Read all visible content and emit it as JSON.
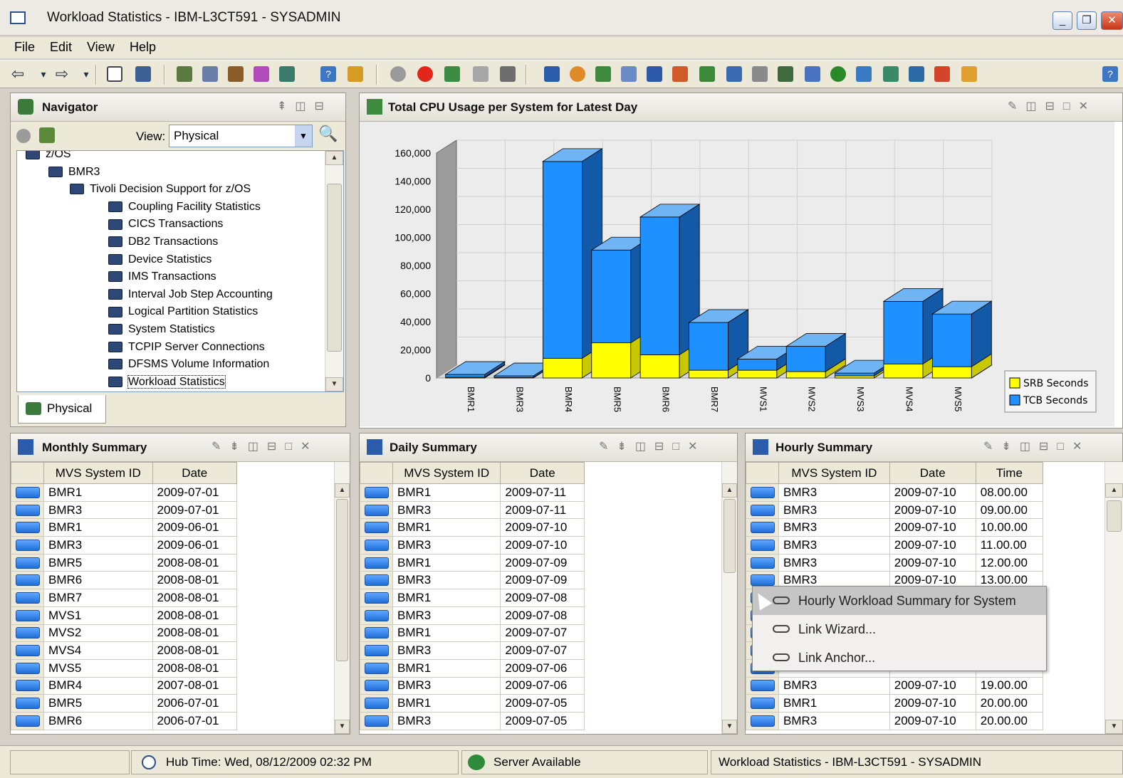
{
  "window": {
    "title": "Workload Statistics - IBM-L3CT591 - SYSADMIN"
  },
  "menu": [
    "File",
    "Edit",
    "View",
    "Help"
  ],
  "navigator": {
    "title": "Navigator",
    "view_label": "View:",
    "view_value": "Physical",
    "tab_label": "Physical",
    "tree": [
      {
        "label": "z/OS",
        "level": 0
      },
      {
        "label": "BMR3",
        "level": 1
      },
      {
        "label": "Tivoli Decision Support for z/OS",
        "level": 2
      },
      {
        "label": "Coupling Facility Statistics",
        "level": 3
      },
      {
        "label": "CICS Transactions",
        "level": 3
      },
      {
        "label": "DB2 Transactions",
        "level": 3
      },
      {
        "label": "Device Statistics",
        "level": 3
      },
      {
        "label": "IMS Transactions",
        "level": 3
      },
      {
        "label": "Interval Job Step Accounting",
        "level": 3
      },
      {
        "label": "Logical Partition Statistics",
        "level": 3
      },
      {
        "label": "System Statistics",
        "level": 3
      },
      {
        "label": "TCPIP Server Connections",
        "level": 3
      },
      {
        "label": "DFSMS Volume Information",
        "level": 3
      },
      {
        "label": "Workload Statistics",
        "level": 3,
        "selected": true
      }
    ]
  },
  "chart_panel": {
    "title": "Total CPU Usage per System for Latest Day"
  },
  "chart_data": {
    "type": "bar",
    "stacked": true,
    "three_d": true,
    "title": "Total CPU Usage per System for Latest Day",
    "categories": [
      "BMR1",
      "BMR3",
      "BMR4",
      "BMR5",
      "BMR6",
      "BMR7",
      "MVS1",
      "MVS2",
      "MVS3",
      "MVS4",
      "MVS5"
    ],
    "series": [
      {
        "name": "SRB Seconds",
        "color": "#ffff00",
        "values": [
          500,
          300,
          14000,
          25000,
          16500,
          5500,
          5500,
          4500,
          1500,
          10000,
          8000
        ]
      },
      {
        "name": "TCB Seconds",
        "color": "#1e90ff",
        "values": [
          2000,
          1200,
          140000,
          66000,
          98000,
          34000,
          8000,
          18000,
          2000,
          44500,
          37500
        ]
      }
    ],
    "y_ticks": [
      "0",
      "20,000",
      "40,000",
      "60,000",
      "80,000",
      "100,000",
      "120,000",
      "140,000",
      "160,000"
    ],
    "ylim": [
      0,
      160000
    ],
    "grid": true,
    "legend_position": "bottom-right"
  },
  "monthly": {
    "title": "Monthly Summary",
    "columns": [
      "MVS System ID",
      "Date"
    ],
    "rows": [
      [
        "BMR1",
        "2009-07-01"
      ],
      [
        "BMR3",
        "2009-07-01"
      ],
      [
        "BMR1",
        "2009-06-01"
      ],
      [
        "BMR3",
        "2009-06-01"
      ],
      [
        "BMR5",
        "2008-08-01"
      ],
      [
        "BMR6",
        "2008-08-01"
      ],
      [
        "BMR7",
        "2008-08-01"
      ],
      [
        "MVS1",
        "2008-08-01"
      ],
      [
        "MVS2",
        "2008-08-01"
      ],
      [
        "MVS4",
        "2008-08-01"
      ],
      [
        "MVS5",
        "2008-08-01"
      ],
      [
        "BMR4",
        "2007-08-01"
      ],
      [
        "BMR5",
        "2006-07-01"
      ],
      [
        "BMR6",
        "2006-07-01"
      ]
    ]
  },
  "daily": {
    "title": "Daily Summary",
    "columns": [
      "MVS System ID",
      "Date"
    ],
    "rows": [
      [
        "BMR1",
        "2009-07-11"
      ],
      [
        "BMR3",
        "2009-07-11"
      ],
      [
        "BMR1",
        "2009-07-10"
      ],
      [
        "BMR3",
        "2009-07-10"
      ],
      [
        "BMR1",
        "2009-07-09"
      ],
      [
        "BMR3",
        "2009-07-09"
      ],
      [
        "BMR1",
        "2009-07-08"
      ],
      [
        "BMR3",
        "2009-07-08"
      ],
      [
        "BMR1",
        "2009-07-07"
      ],
      [
        "BMR3",
        "2009-07-07"
      ],
      [
        "BMR1",
        "2009-07-06"
      ],
      [
        "BMR3",
        "2009-07-06"
      ],
      [
        "BMR1",
        "2009-07-05"
      ],
      [
        "BMR3",
        "2009-07-05"
      ]
    ]
  },
  "hourly": {
    "title": "Hourly Summary",
    "columns": [
      "MVS System ID",
      "Date",
      "Time"
    ],
    "rows": [
      [
        "BMR3",
        "2009-07-10",
        "08.00.00"
      ],
      [
        "BMR3",
        "2009-07-10",
        "09.00.00"
      ],
      [
        "BMR3",
        "2009-07-10",
        "10.00.00"
      ],
      [
        "BMR3",
        "2009-07-10",
        "11.00.00"
      ],
      [
        "BMR3",
        "2009-07-10",
        "12.00.00"
      ],
      [
        "BMR3",
        "2009-07-10",
        "13.00.00"
      ],
      [
        "",
        "",
        ""
      ],
      [
        "",
        "",
        ""
      ],
      [
        "",
        "",
        ""
      ],
      [
        "",
        "",
        ""
      ],
      [
        "",
        "",
        ""
      ],
      [
        "BMR3",
        "2009-07-10",
        "19.00.00"
      ],
      [
        "BMR1",
        "2009-07-10",
        "20.00.00"
      ],
      [
        "BMR3",
        "2009-07-10",
        "20.00.00"
      ]
    ]
  },
  "context_menu": {
    "items": [
      "Hourly Workload Summary for System",
      "Link Wizard...",
      "Link Anchor..."
    ]
  },
  "status": {
    "hub_time": "Hub Time: Wed, 08/12/2009 02:32 PM",
    "server": "Server Available",
    "window": "Workload Statistics - IBM-L3CT591 - SYSADMIN"
  }
}
